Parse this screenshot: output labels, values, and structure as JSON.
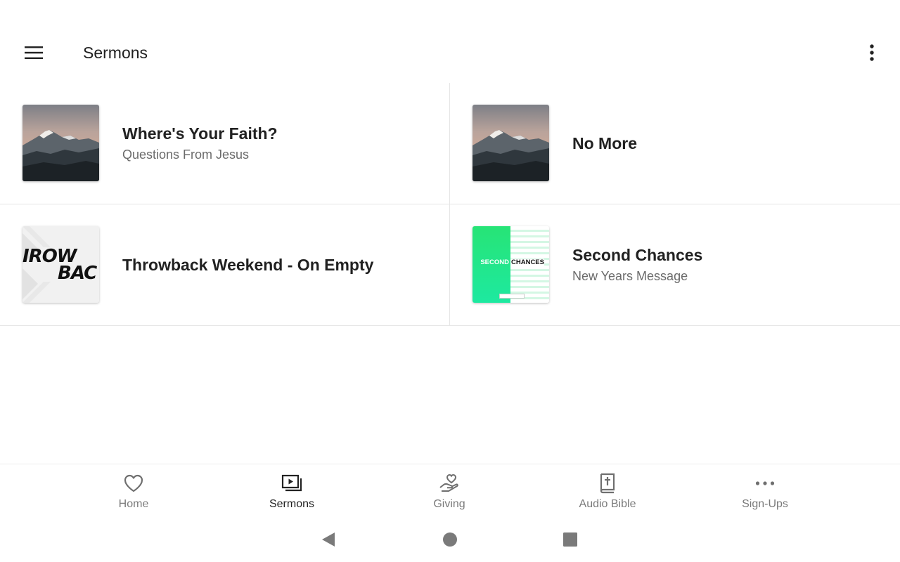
{
  "header": {
    "title": "Sermons",
    "menu_icon": "hamburger-menu-icon",
    "overflow_icon": "more-vertical-icon"
  },
  "sermons": [
    {
      "title": "Where's Your Faith?",
      "subtitle": "Questions From Jesus",
      "artwork": "mountain-artwork"
    },
    {
      "title": "No More",
      "subtitle": "",
      "artwork": "mountain-artwork"
    },
    {
      "title": "Throwback Weekend - On Empty",
      "subtitle": "",
      "artwork": "throwback-artwork",
      "artwork_text_top": "IROW",
      "artwork_text_bottom": "BAC"
    },
    {
      "title": "Second Chances",
      "subtitle": "New Years Message",
      "artwork": "second-chances-artwork",
      "artwork_text_left": "SECOND",
      "artwork_text_right": "CHANCES"
    }
  ],
  "bottom_nav": {
    "items": [
      {
        "label": "Home",
        "icon": "heart-icon",
        "active": false
      },
      {
        "label": "Sermons",
        "icon": "video-library-icon",
        "active": true
      },
      {
        "label": "Giving",
        "icon": "giving-hand-icon",
        "active": false
      },
      {
        "label": "Audio Bible",
        "icon": "bible-icon",
        "active": false
      },
      {
        "label": "Sign-Ups",
        "icon": "more-horizontal-icon",
        "active": false
      }
    ]
  },
  "system_nav": {
    "back_icon": "back-triangle-icon",
    "home_icon": "home-circle-icon",
    "recents_icon": "recents-square-icon"
  },
  "colors": {
    "accent_green": "#1de97a",
    "text_primary": "#212121",
    "text_secondary": "#6b6b6b",
    "divider": "#e6e6e6"
  }
}
